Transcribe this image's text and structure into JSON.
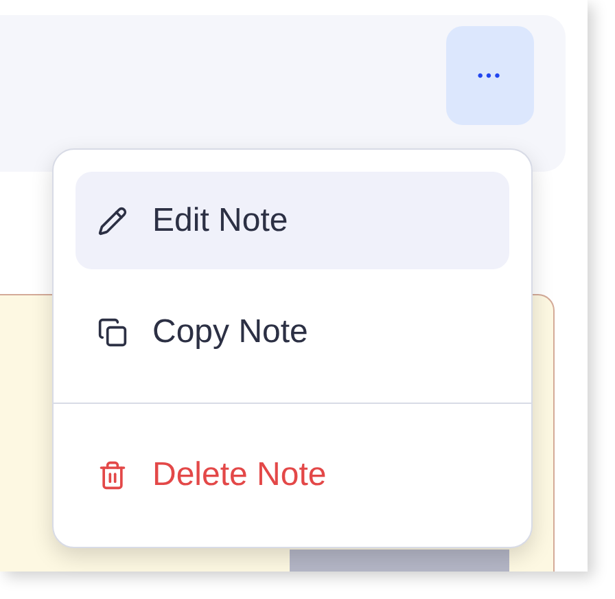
{
  "more_button": {
    "label": "•••",
    "selected": true
  },
  "menu": {
    "items": [
      {
        "kind": "edit",
        "label": "Edit Note",
        "selected": true
      },
      {
        "kind": "copy",
        "label": "Copy Note",
        "selected": false
      },
      {
        "kind": "delete",
        "label": "Delete Note",
        "selected": false
      }
    ]
  }
}
